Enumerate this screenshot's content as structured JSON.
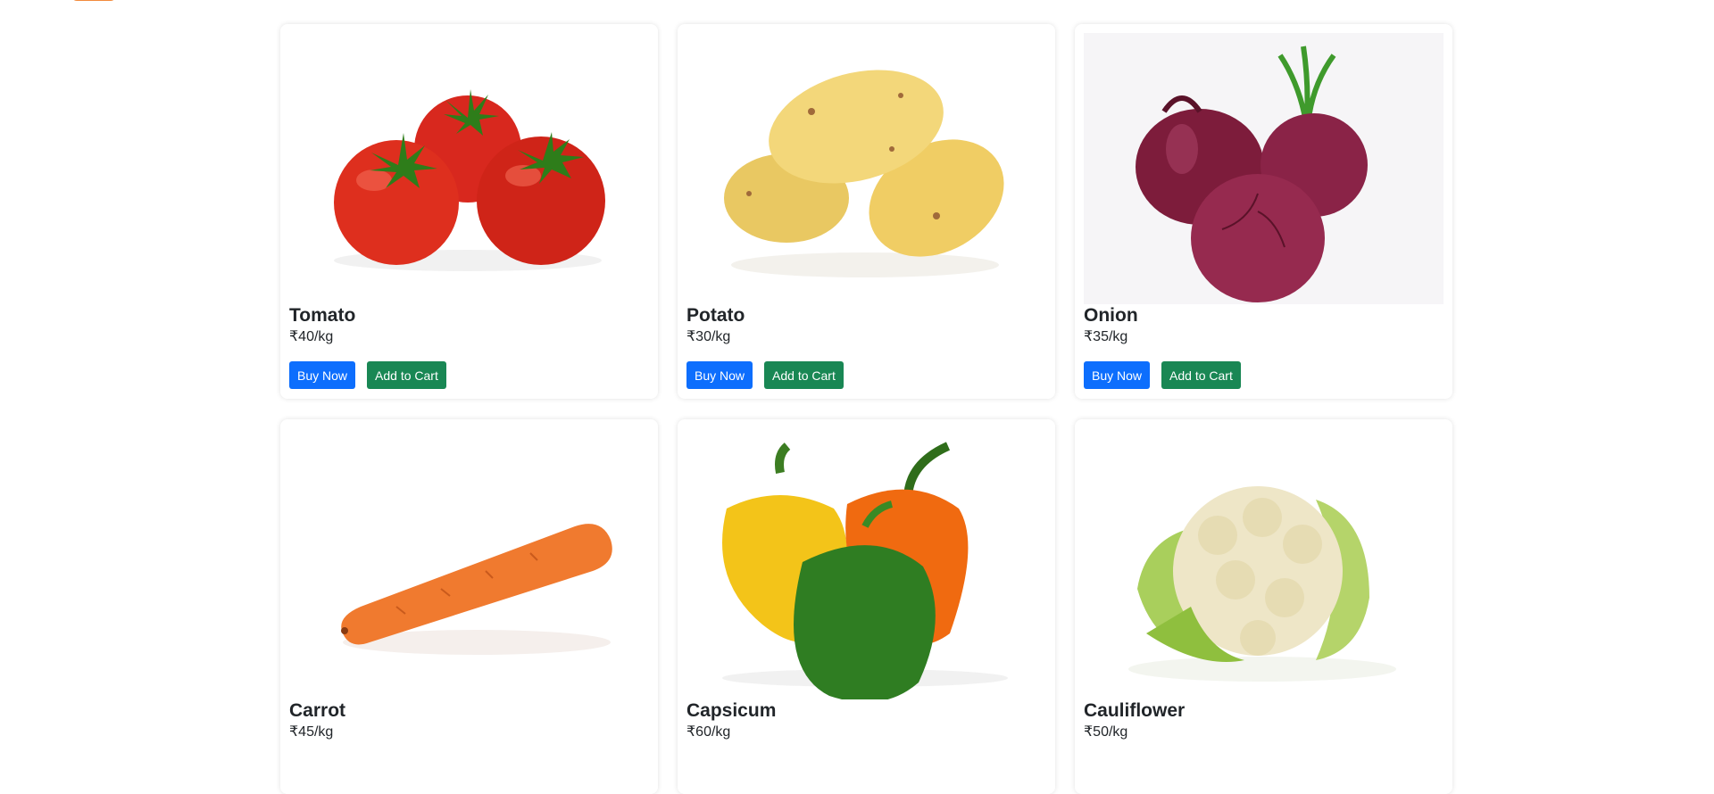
{
  "products": [
    {
      "name": "Tomato",
      "price": "₹40/kg",
      "icon": "tomato-image"
    },
    {
      "name": "Potato",
      "price": "₹30/kg",
      "icon": "potato-image"
    },
    {
      "name": "Onion",
      "price": "₹35/kg",
      "icon": "onion-image"
    },
    {
      "name": "Carrot",
      "price": "₹45/kg",
      "icon": "carrot-image"
    },
    {
      "name": "Capsicum",
      "price": "₹60/kg",
      "icon": "capsicum-image"
    },
    {
      "name": "Cauliflower",
      "price": "₹50/kg",
      "icon": "cauliflower-image"
    }
  ],
  "buttons": {
    "buy_label": "Buy Now",
    "cart_label": "Add to Cart"
  },
  "colors": {
    "buy": "#0d6efd",
    "cart": "#198754",
    "accent": "#f28a3c"
  }
}
